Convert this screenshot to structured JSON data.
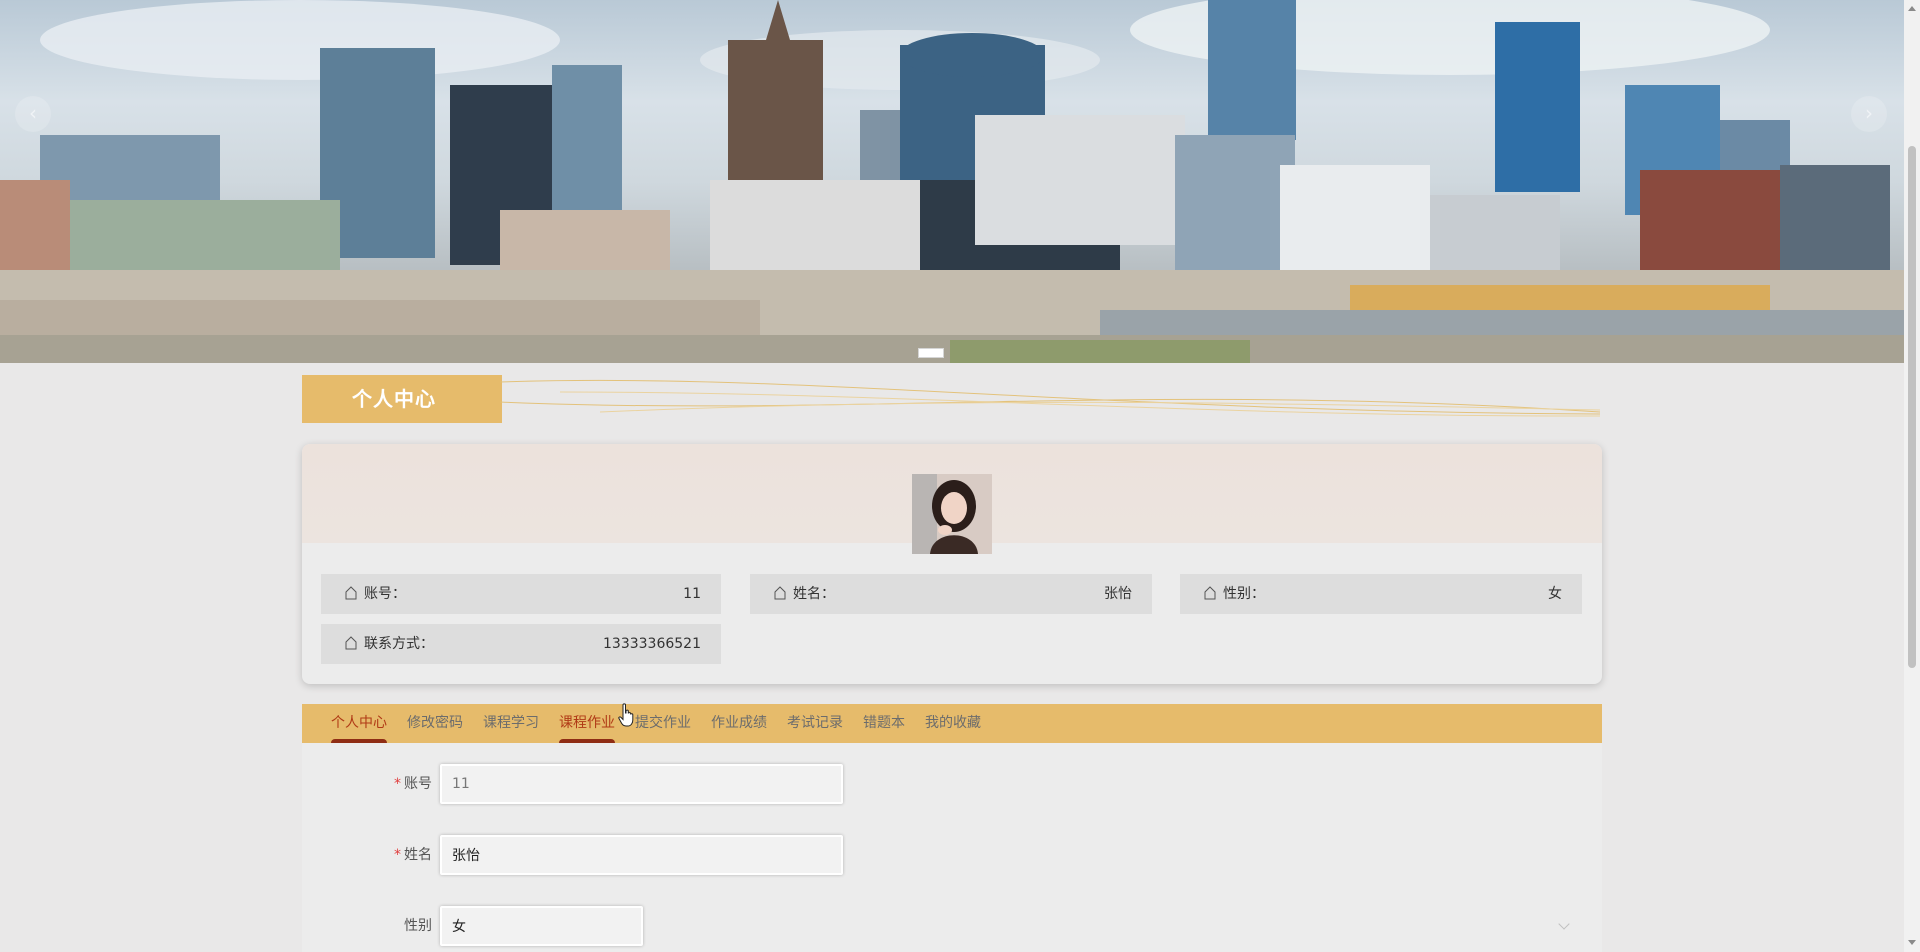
{
  "banner": {
    "prev_label": "‹",
    "next_label": "›"
  },
  "section_title": "个人中心",
  "profile": {
    "avatar_icon": "user-avatar-photo",
    "fields": {
      "account": {
        "label": "账号：",
        "value": "11"
      },
      "name": {
        "label": "姓名：",
        "value": "张怡"
      },
      "gender": {
        "label": "性别：",
        "value": "女"
      },
      "contact": {
        "label": "联系方式：",
        "value": "13333366521"
      }
    }
  },
  "tabs": [
    {
      "label": "个人中心",
      "active": true
    },
    {
      "label": "修改密码",
      "active": false
    },
    {
      "label": "课程学习",
      "active": false
    },
    {
      "label": "课程作业",
      "active": true
    },
    {
      "label": "提交作业",
      "active": false
    },
    {
      "label": "作业成绩",
      "active": false
    },
    {
      "label": "考试记录",
      "active": false
    },
    {
      "label": "错题本",
      "active": false
    },
    {
      "label": "我的收藏",
      "active": false
    }
  ],
  "form": {
    "account": {
      "label": "账号",
      "required": "*",
      "value": "11"
    },
    "name": {
      "label": "姓名",
      "required": "*",
      "value": "张怡"
    },
    "gender": {
      "label": "性别",
      "value": "女"
    }
  },
  "colors": {
    "accent": "#e6bb6b",
    "tab_active": "#b03a16",
    "tab_underline": "#8f2d14",
    "required": "#e03c3c"
  }
}
